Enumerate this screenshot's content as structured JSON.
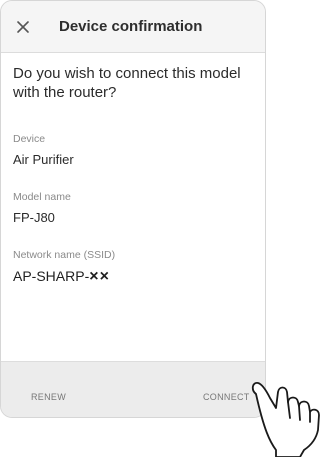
{
  "dialog": {
    "title": "Device confirmation",
    "question": "Do you wish to connect this model with the router?"
  },
  "fields": {
    "device": {
      "label": "Device",
      "value": "Air Purifier"
    },
    "model": {
      "label": "Model name",
      "value": "FP-J80"
    },
    "ssid": {
      "label": "Network name (SSID)",
      "value_prefix": "AP-SHARP-",
      "value_suffix": "××"
    }
  },
  "footer": {
    "renew_label": "RENEW",
    "connect_label": "CONNECT"
  },
  "icons": {
    "close": "close-icon",
    "hand": "pointing-hand-icon"
  },
  "colors": {
    "title_bar": "#f5f5f5",
    "footer": "#ececec",
    "text": "#2b2b2b",
    "label": "#8a8a8a"
  }
}
